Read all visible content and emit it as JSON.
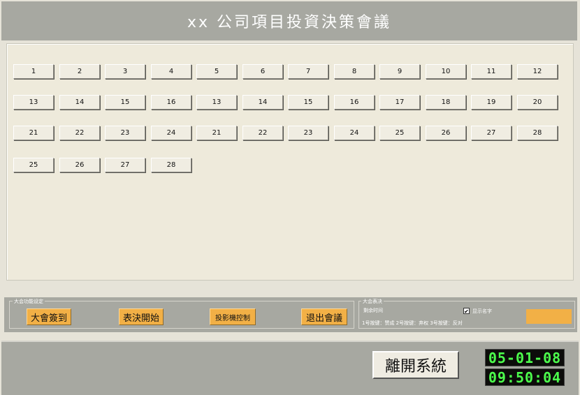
{
  "window": {
    "title": "xx 公司項目投資決策會議"
  },
  "grid": {
    "rows": [
      [
        "1",
        "2",
        "3",
        "4",
        "5",
        "6",
        "7",
        "8",
        "9",
        "10",
        "11",
        "12"
      ],
      [
        "13",
        "14",
        "15",
        "16",
        "13",
        "14",
        "15",
        "16",
        "17",
        "18",
        "19",
        "20"
      ],
      [
        "21",
        "22",
        "23",
        "24",
        "21",
        "22",
        "23",
        "24",
        "25",
        "26",
        "27",
        "28"
      ],
      [
        "25",
        "26",
        "27",
        "28"
      ]
    ]
  },
  "function_panel": {
    "legend": "大会功能设定",
    "buttons": [
      "大會簽到",
      "表決開始",
      "投影機控制",
      "退出會議"
    ]
  },
  "vote_panel": {
    "legend": "大会表决",
    "remaining_time_label": "剩余时间",
    "show_name_label": "显示名字",
    "show_name_checked": true,
    "key_hint": "1号按键：赞成 2号按键：弃权 3号按键：反对"
  },
  "bottom": {
    "exit_label": "離開系統",
    "date": "05-01-08",
    "time": "09:50:04"
  },
  "colors": {
    "panel_gray": "#a7a8a1",
    "button_orange": "#f2b046",
    "digit_green": "#4cff4c"
  }
}
